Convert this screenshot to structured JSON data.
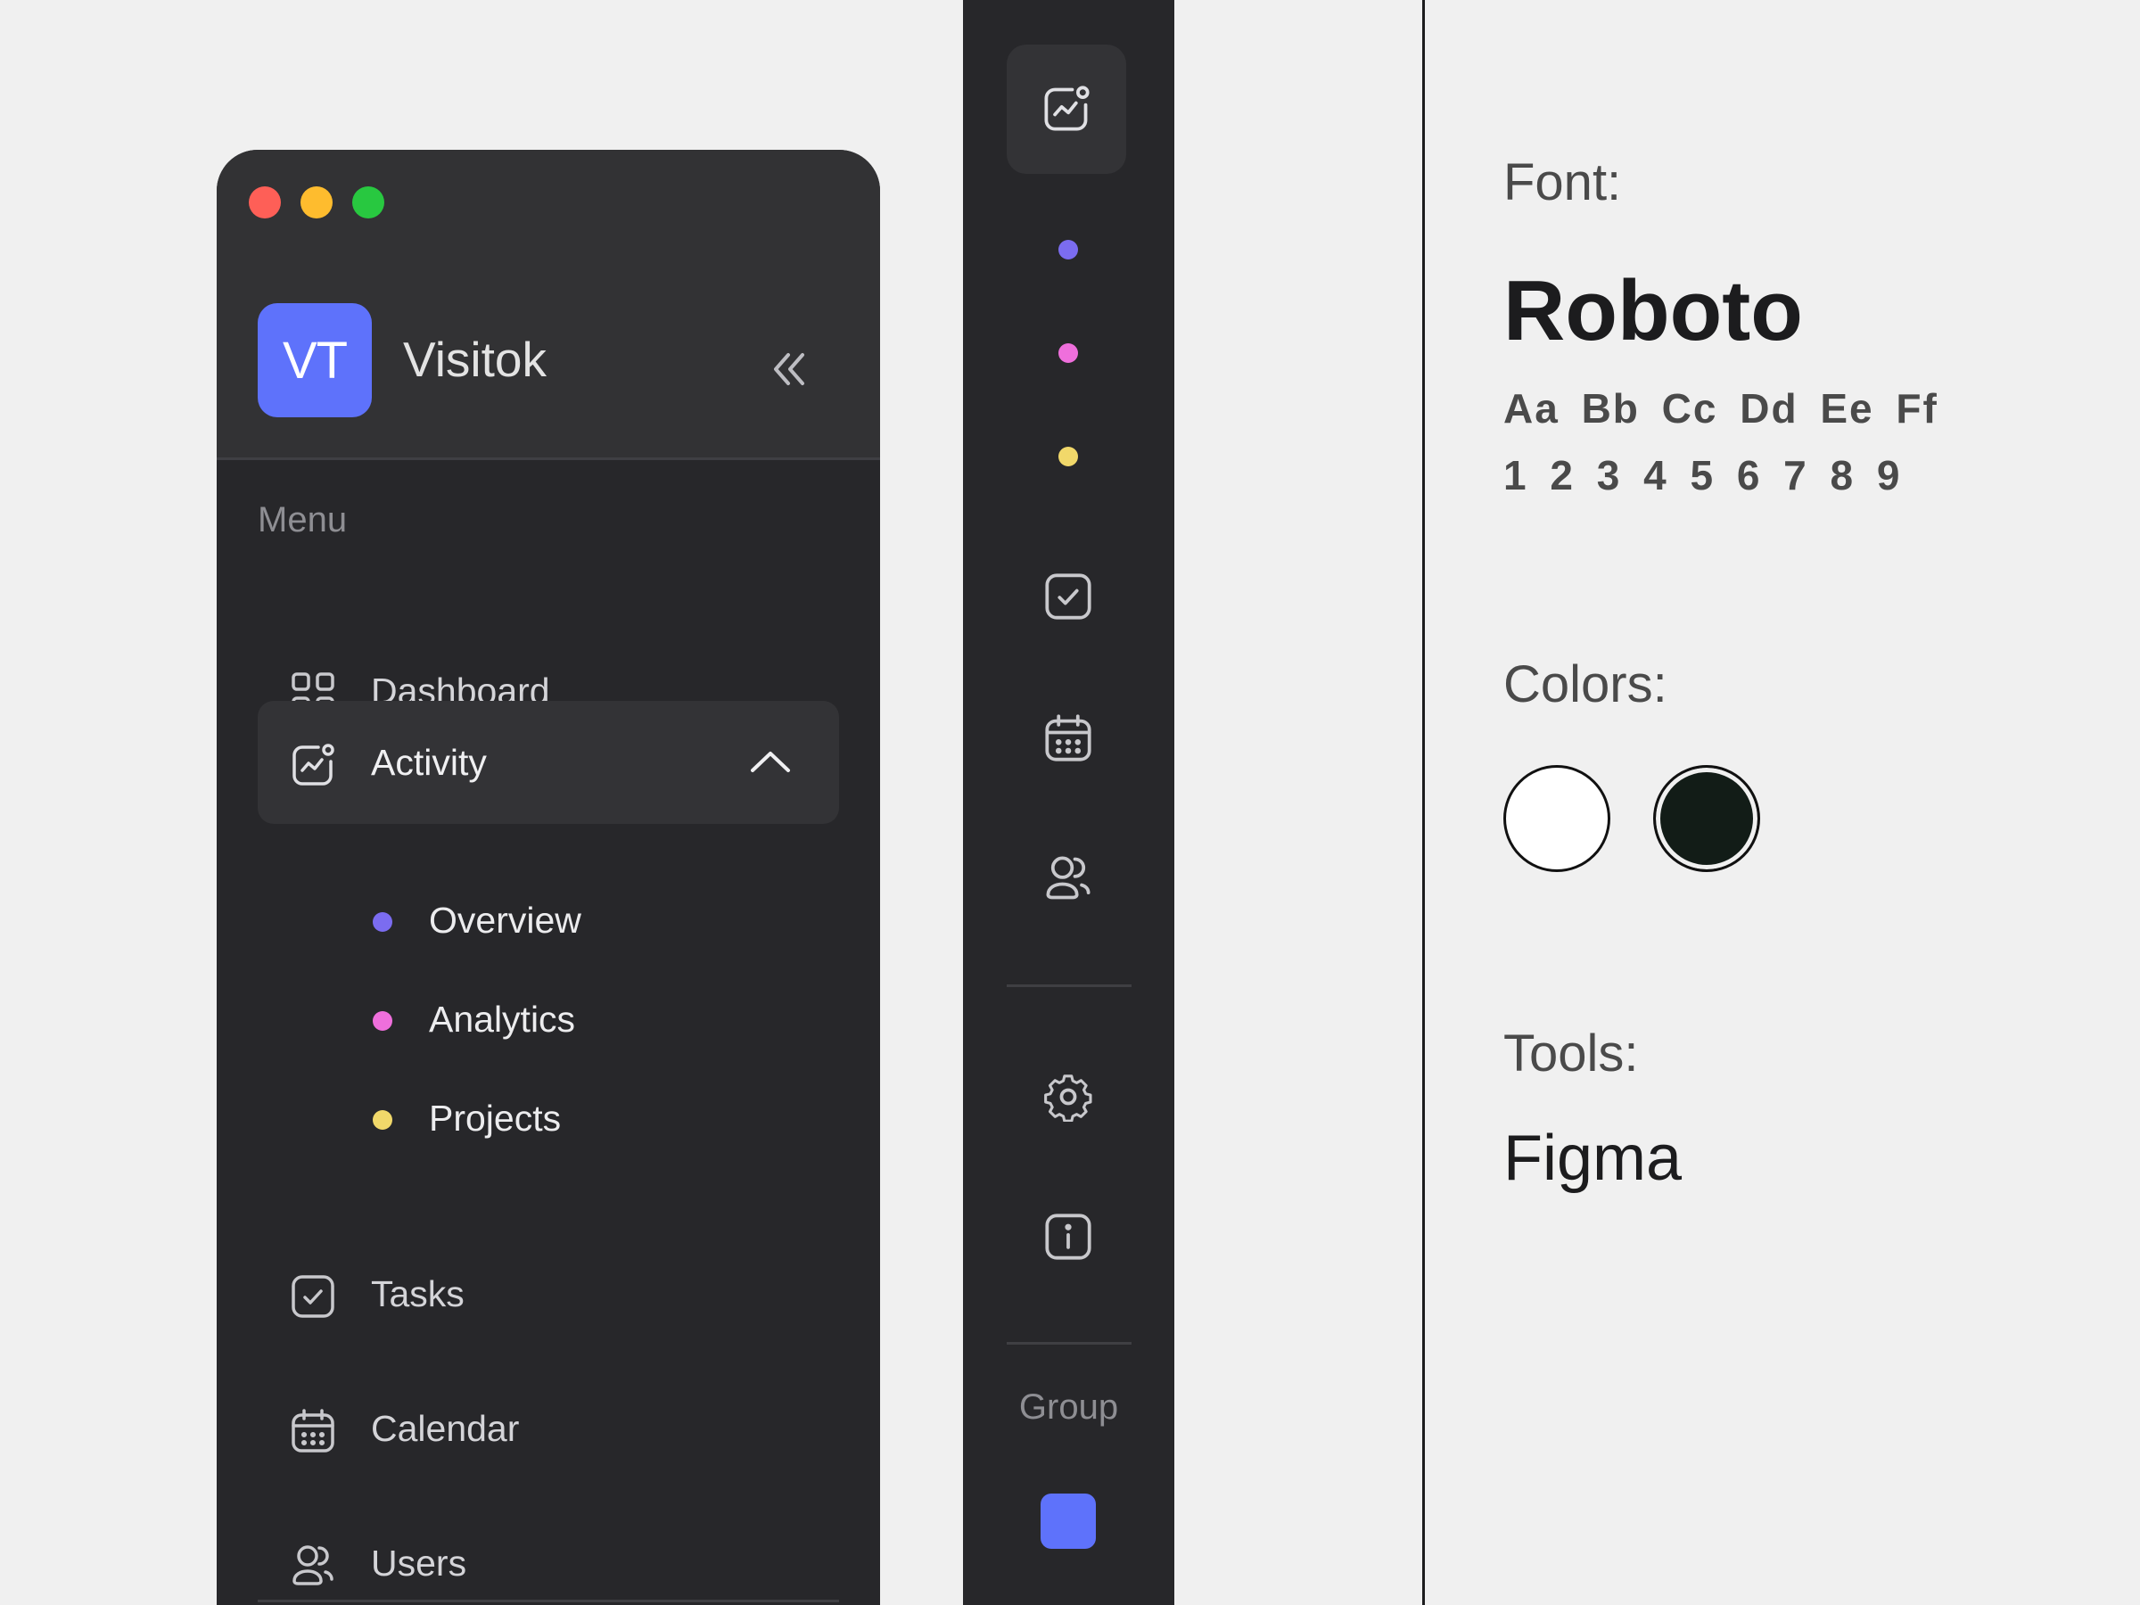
{
  "sidebar": {
    "brand": {
      "initials": "VT",
      "name": "Visitok"
    },
    "menu_label": "Menu",
    "items": [
      {
        "label": "Dashboard",
        "icon": "grid-icon"
      },
      {
        "label": "Activity",
        "icon": "activity-chart-icon",
        "expanded": true
      },
      {
        "label": "Tasks",
        "icon": "checkbox-icon"
      },
      {
        "label": "Calendar",
        "icon": "calendar-icon"
      },
      {
        "label": "Users",
        "icon": "users-icon"
      }
    ],
    "sub_items": [
      {
        "label": "Overview",
        "color": "#7b6cf0"
      },
      {
        "label": "Analytics",
        "color": "#ef6fdc"
      },
      {
        "label": "Projects",
        "color": "#f1d86a"
      }
    ]
  },
  "rail": {
    "group_label": "Group",
    "avatar_color": "#5e72fb"
  },
  "info": {
    "font_heading": "Font:",
    "font_name": "Roboto",
    "glyphs_letters": "Aa Bb Cc Dd Ee Ff",
    "glyphs_numbers": "1 2 3 4 5 6 7 8 9",
    "colors_heading": "Colors:",
    "colors": [
      "#ffffff",
      "#121c17"
    ],
    "tools_heading": "Tools:",
    "tool_name": "Figma"
  },
  "theme": {
    "panel_bg": "#27272a",
    "header_bg": "#323234",
    "accent": "#5e72fb"
  }
}
